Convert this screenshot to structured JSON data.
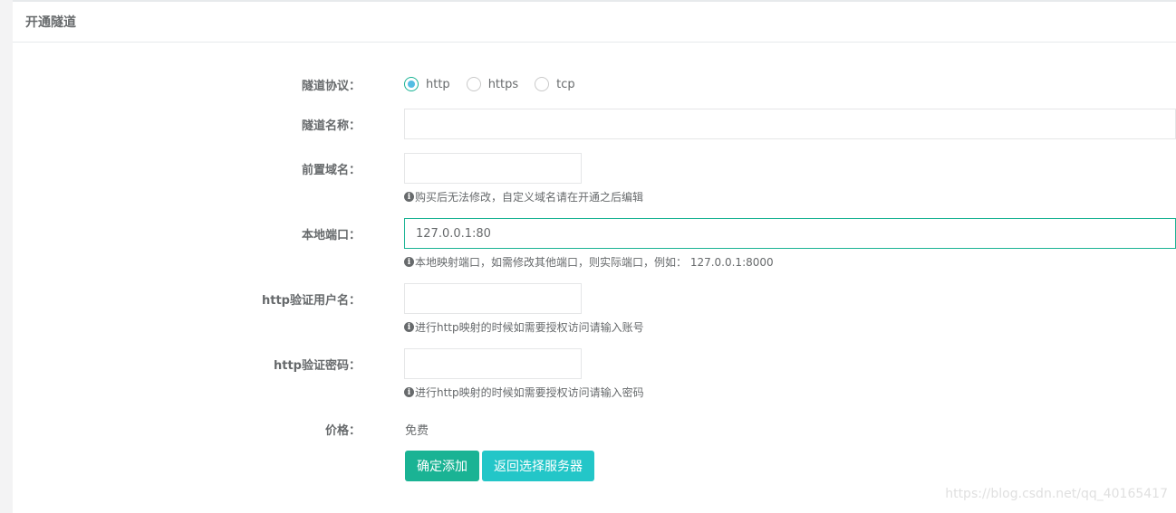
{
  "panel": {
    "title": "开通隧道"
  },
  "form": {
    "protocol": {
      "label": "隧道协议：",
      "options": [
        {
          "label": "http",
          "checked": true
        },
        {
          "label": "https",
          "checked": false
        },
        {
          "label": "tcp",
          "checked": false
        }
      ]
    },
    "tunnel_name": {
      "label": "隧道名称：",
      "value": ""
    },
    "prefix_domain": {
      "label": "前置域名：",
      "value": "",
      "help": "购买后无法修改，自定义域名请在开通之后编辑"
    },
    "local_port": {
      "label": "本地端口：",
      "value": "127.0.0.1:80",
      "help": "本地映射端口，如需修改其他端口，则实际端口，例如： 127.0.0.1:8000"
    },
    "http_user": {
      "label": "http验证用户名：",
      "value": "",
      "help": "进行http映射的时候如需要授权访问请输入账号"
    },
    "http_password": {
      "label": "http验证密码：",
      "value": "",
      "help": "进行http映射的时候如需要授权访问请输入密码"
    },
    "price": {
      "label": "价格：",
      "value": "免费"
    }
  },
  "buttons": {
    "confirm": "确定添加",
    "back": "返回选择服务器"
  },
  "watermark": "https://blog.csdn.net/qq_40165417",
  "colors": {
    "primary": "#1ab394",
    "info": "#23c6c8",
    "radio_dot": "#53bde3"
  },
  "icons": {
    "help": "info-circle-icon"
  }
}
